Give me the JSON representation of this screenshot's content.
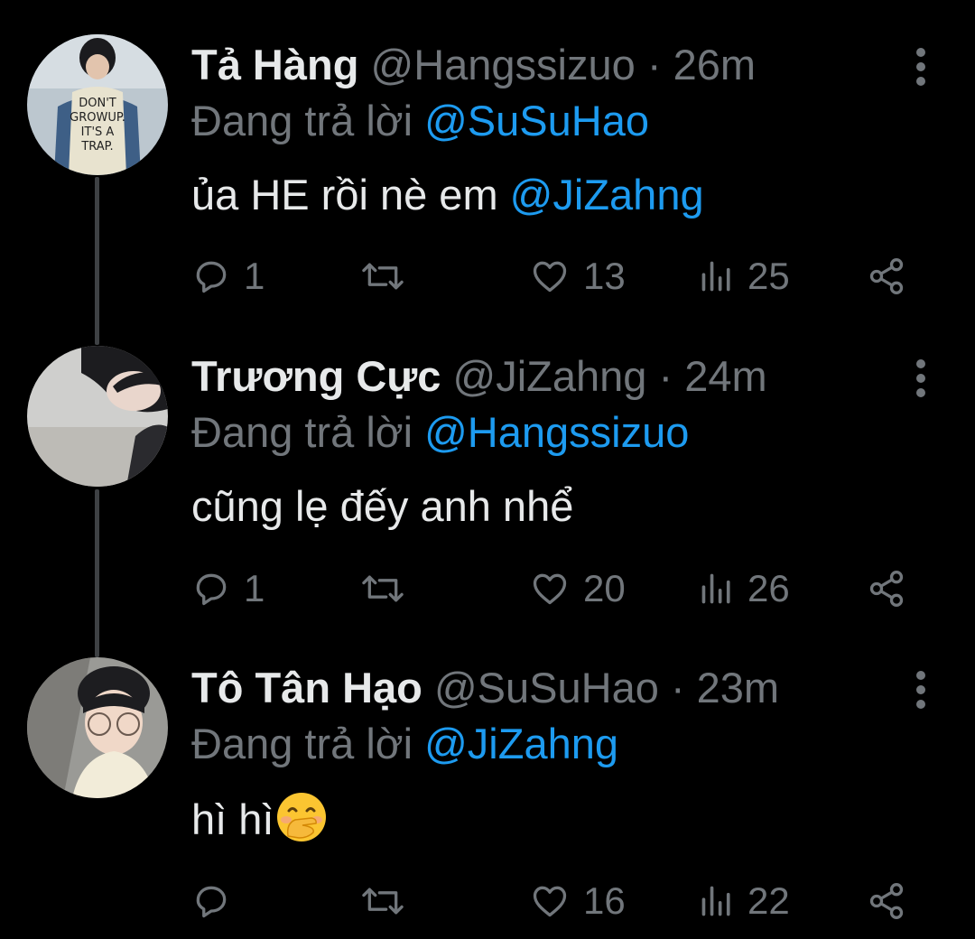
{
  "reply_prefix": "Đang trả lời",
  "tweets": [
    {
      "name": "Tả Hàng",
      "handle": "@Hangssizuo",
      "dot": "·",
      "time": "26m",
      "replying_to": "@SuSuHao",
      "text": "ủa HE rồi nè em ",
      "text_mention": "@JiZahng",
      "emoji": "",
      "stats": {
        "replies": "1",
        "retweets": "",
        "likes": "13",
        "views": "25"
      }
    },
    {
      "name": "Trương Cực",
      "handle": "@JiZahng",
      "dot": "·",
      "time": "24m",
      "replying_to": "@Hangssizuo",
      "text": "cũng lẹ đếy anh nhể",
      "text_mention": "",
      "emoji": "",
      "stats": {
        "replies": "1",
        "retweets": "",
        "likes": "20",
        "views": "26"
      }
    },
    {
      "name": "Tô Tân Hạo",
      "handle": "@SuSuHao",
      "dot": "·",
      "time": "23m",
      "replying_to": "@JiZahng",
      "text": "hì hì",
      "text_mention": "",
      "emoji": "face-with-hand-over-mouth",
      "stats": {
        "replies": "",
        "retweets": "",
        "likes": "16",
        "views": "22"
      }
    }
  ],
  "icons": {
    "reply": "reply-icon",
    "retweet": "retweet-icon",
    "like": "heart-icon",
    "views": "views-icon",
    "share": "share-icon",
    "more": "more-vertical-icon"
  },
  "colors": {
    "background": "#000000",
    "primary_text": "#e7e9ea",
    "secondary_text": "#71767b",
    "mention": "#1d9bf0",
    "thread_line": "#3e4144"
  }
}
